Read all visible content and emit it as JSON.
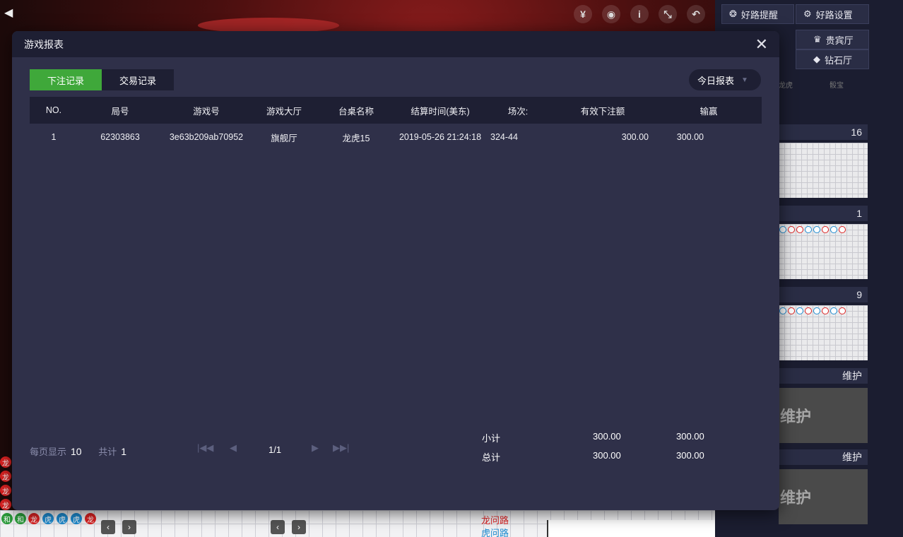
{
  "modal": {
    "title": "游戏报表",
    "tabs": [
      "下注记录",
      "交易记录"
    ],
    "report_select": "今日报表"
  },
  "table": {
    "headers": [
      "NO.",
      "局号",
      "游戏号",
      "游戏大厅",
      "台桌名称",
      "结算时间(美东)",
      "场次:",
      "有效下注额",
      "输赢"
    ],
    "rows": [
      [
        "1",
        "62303863",
        "3e63b209ab70952",
        "旗舰厅",
        "龙虎15",
        "2019-05-26 21:24:18",
        "324-44",
        "300.00",
        "300.00"
      ]
    ]
  },
  "pager": {
    "per_page_label": "每页显示",
    "per_page_value": "10",
    "total_label": "共计",
    "total_value": "1",
    "page": "1/1"
  },
  "totals": {
    "subtotal_label": "小计",
    "subtotal_bet": "300.00",
    "subtotal_win": "300.00",
    "total_label": "总计",
    "total_bet": "300.00",
    "total_win": "300.00"
  },
  "sidebar": {
    "road_alert": "好路提醒",
    "road_settings": "好路设置",
    "vip_hall": "贵宾厅",
    "diamond_hall": "钻石厅",
    "tab_longhu": "龙虎",
    "tab_other": "骰宝",
    "tables": [
      "16",
      "1",
      "9",
      "维护",
      "维护"
    ],
    "maintenance_text": "维护"
  },
  "bottom": {
    "dragon_road": "龙问路",
    "tiger_road": "虎问路"
  },
  "colors": {
    "accent_green": "#3fa83a",
    "modal_bg": "#2f3049",
    "header_bg": "#1e1f33"
  }
}
